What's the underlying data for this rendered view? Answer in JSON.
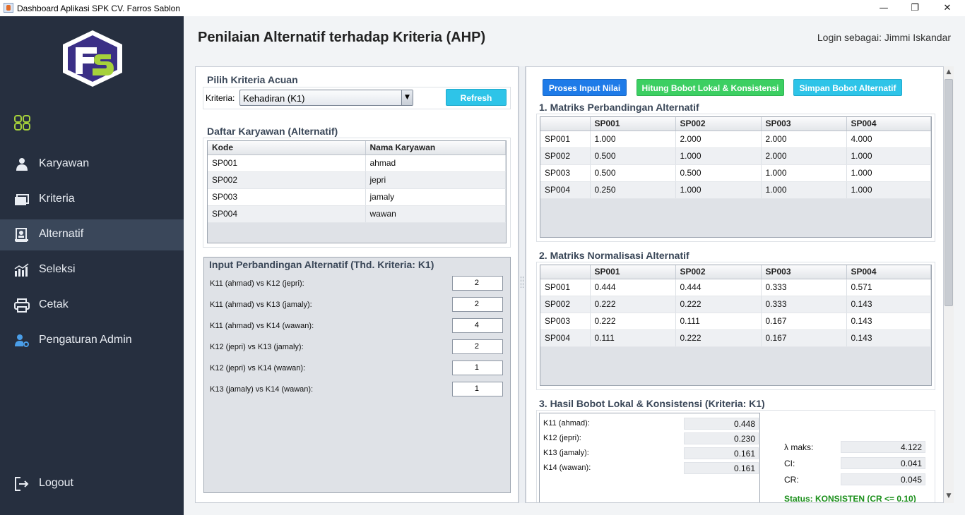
{
  "window": {
    "title": "Dashboard Aplikasi SPK CV. Farros Sablon",
    "min": "—",
    "max": "❐",
    "close": "✕"
  },
  "sidebar": {
    "logo_text": "FS",
    "menu_icon": "grid-icon",
    "items": [
      {
        "label": "Karyawan",
        "icon": "user-icon",
        "active": false
      },
      {
        "label": "Kriteria",
        "icon": "folders-icon",
        "active": false
      },
      {
        "label": "Alternatif",
        "icon": "document-person-icon",
        "active": true
      },
      {
        "label": "Seleksi",
        "icon": "bar-chart-icon",
        "active": false
      },
      {
        "label": "Cetak",
        "icon": "printer-icon",
        "active": false
      },
      {
        "label": "Pengaturan Admin",
        "icon": "user-settings-icon",
        "active": false
      }
    ],
    "logout": "Logout"
  },
  "header": {
    "title": "Penilaian Alternatif terhadap Kriteria (AHP)",
    "login": "Login sebagai: Jimmi Iskandar"
  },
  "left": {
    "criteria_section": "Pilih Kriteria Acuan",
    "criteria_label": "Kriteria:",
    "criteria_value": "Kehadiran (K1)",
    "refresh": "Refresh",
    "employees_section": "Daftar Karyawan (Alternatif)",
    "employees_headers": [
      "Kode",
      "Nama Karyawan"
    ],
    "employees": [
      [
        "SP001",
        "ahmad"
      ],
      [
        "SP002",
        "jepri"
      ],
      [
        "SP003",
        "jamaly"
      ],
      [
        "SP004",
        "wawan"
      ]
    ],
    "input_section": "Input Perbandingan Alternatif (Thd. Kriteria: K1)",
    "comparisons": [
      {
        "label": "K11 (ahmad) vs K12 (jepri):",
        "value": "2"
      },
      {
        "label": "K11 (ahmad) vs K13 (jamaly):",
        "value": "2"
      },
      {
        "label": "K11 (ahmad) vs K14 (wawan):",
        "value": "4"
      },
      {
        "label": "K12 (jepri) vs K13 (jamaly):",
        "value": "2"
      },
      {
        "label": "K12 (jepri) vs K14 (wawan):",
        "value": "1"
      },
      {
        "label": "K13 (jamaly) vs K14 (wawan):",
        "value": "1"
      }
    ]
  },
  "right": {
    "buttons": {
      "proses": "Proses Input Nilai",
      "hitung": "Hitung Bobot Lokal & Konsistensi",
      "simpan": "Simpan Bobot Alternatif"
    },
    "matrix1_title": "1. Matriks Perbandingan Alternatif",
    "matrix2_title": "2. Matriks Normalisasi Alternatif",
    "matrix_headers": [
      "",
      "SP001",
      "SP002",
      "SP003",
      "SP004"
    ],
    "matrix1": [
      [
        "SP001",
        "1.000",
        "2.000",
        "2.000",
        "4.000"
      ],
      [
        "SP002",
        "0.500",
        "1.000",
        "2.000",
        "1.000"
      ],
      [
        "SP003",
        "0.500",
        "0.500",
        "1.000",
        "1.000"
      ],
      [
        "SP004",
        "0.250",
        "1.000",
        "1.000",
        "1.000"
      ]
    ],
    "matrix2": [
      [
        "SP001",
        "0.444",
        "0.444",
        "0.333",
        "0.571"
      ],
      [
        "SP002",
        "0.222",
        "0.222",
        "0.333",
        "0.143"
      ],
      [
        "SP003",
        "0.222",
        "0.111",
        "0.167",
        "0.143"
      ],
      [
        "SP004",
        "0.111",
        "0.222",
        "0.167",
        "0.143"
      ]
    ],
    "result_title": "3. Hasil Bobot Lokal & Konsistensi (Kriteria: K1)",
    "weights": [
      {
        "label": "K11 (ahmad):",
        "value": "0.448"
      },
      {
        "label": "K12 (jepri):",
        "value": "0.230"
      },
      {
        "label": "K13 (jamaly):",
        "value": "0.161"
      },
      {
        "label": "K14 (wawan):",
        "value": "0.161"
      }
    ],
    "consistency": [
      {
        "label": "λ maks:",
        "value": "4.122"
      },
      {
        "label": "CI:",
        "value": "0.041"
      },
      {
        "label": "CR:",
        "value": "0.045"
      }
    ],
    "status": "Status: KONSISTEN (CR <= 0.10)"
  },
  "colors": {
    "sidebar": "#262f3f",
    "btn_blue": "#1e7be8",
    "btn_green": "#3ccf62",
    "btn_cyan": "#2ec4e8",
    "status_green": "#1a8f1a"
  }
}
